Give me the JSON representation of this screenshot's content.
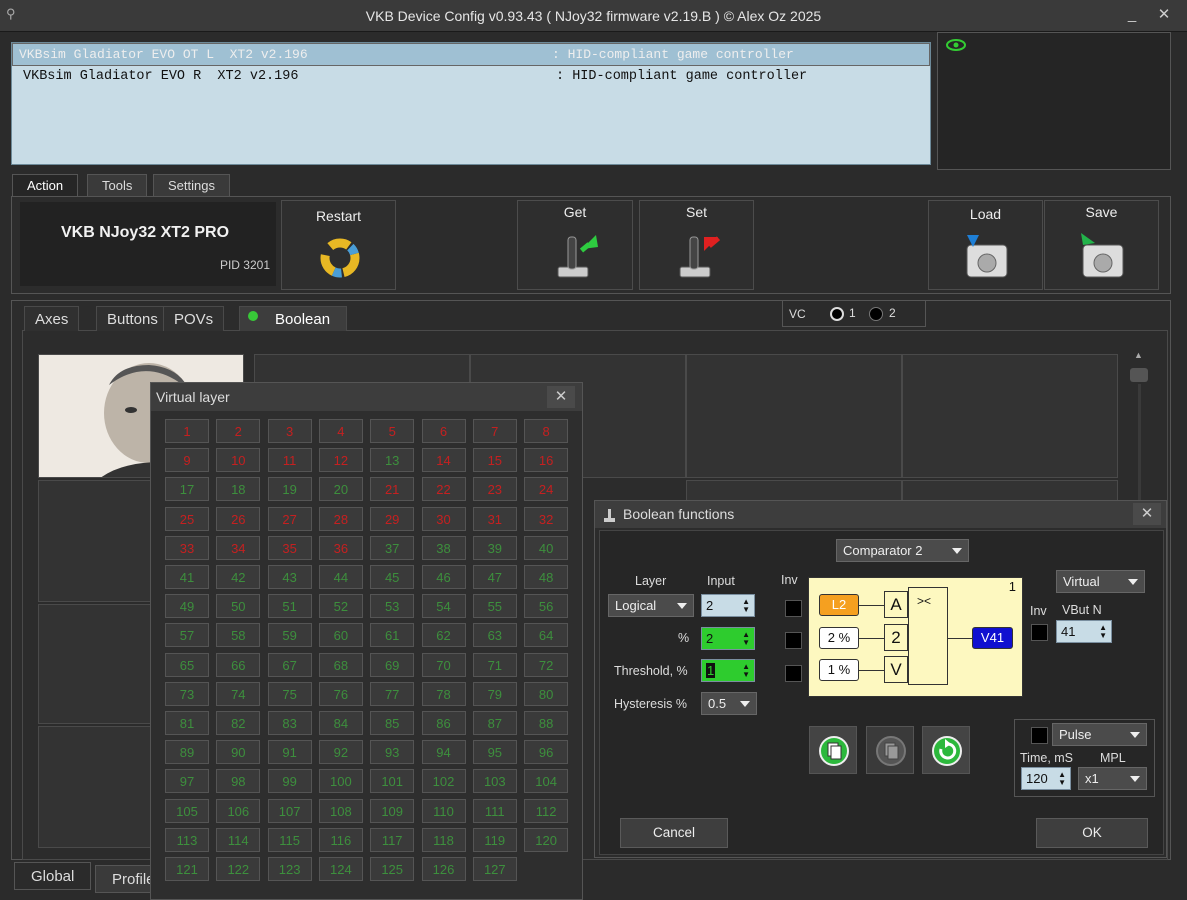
{
  "window": {
    "title": "VKB Device Config v0.93.43 ( NJoy32 firmware v2.19.B ) © Alex Oz 2025",
    "minimize_label": "_",
    "close_label": "✕"
  },
  "devices": [
    {
      "name": "VKBsim Gladiator EVO OT L  XT2 v2.196",
      "type": ": HID-compliant game controller"
    },
    {
      "name": "VKBsim Gladiator EVO R  XT2 v2.196",
      "type": ": HID-compliant game controller"
    }
  ],
  "main_tabs": [
    "Action",
    "Tools",
    "Settings"
  ],
  "action": {
    "device_name": "VKB NJoy32 XT2 PRO",
    "pid": "PID 3201",
    "restart_label": "Restart",
    "get_label": "Get",
    "set_label": "Set",
    "load_label": "Load",
    "save_label": "Save"
  },
  "sub_tabs": [
    "Axes",
    "Buttons",
    "POVs",
    "Boolean"
  ],
  "vc": {
    "label": "VC",
    "opt1": "1",
    "opt2": "2"
  },
  "bottom_tabs": [
    "Global",
    "Profile"
  ],
  "virtual_layer": {
    "title": "Virtual layer",
    "close_label": "✕",
    "buttons": [
      "1",
      "2",
      "3",
      "4",
      "5",
      "6",
      "7",
      "8",
      "9",
      "10",
      "11",
      "12",
      "13",
      "14",
      "15",
      "16",
      "17",
      "18",
      "19",
      "20",
      "21",
      "22",
      "23",
      "24",
      "25",
      "26",
      "27",
      "28",
      "29",
      "30",
      "31",
      "32",
      "33",
      "34",
      "35",
      "36",
      "37",
      "38",
      "39",
      "40",
      "41",
      "42",
      "43",
      "44",
      "45",
      "46",
      "47",
      "48",
      "49",
      "50",
      "51",
      "52",
      "53",
      "54",
      "55",
      "56",
      "57",
      "58",
      "59",
      "60",
      "61",
      "62",
      "63",
      "64",
      "65",
      "66",
      "67",
      "68",
      "69",
      "70",
      "71",
      "72",
      "73",
      "74",
      "75",
      "76",
      "77",
      "78",
      "79",
      "80",
      "81",
      "82",
      "83",
      "84",
      "85",
      "86",
      "87",
      "88",
      "89",
      "90",
      "91",
      "92",
      "93",
      "94",
      "95",
      "96",
      "97",
      "98",
      "99",
      "100",
      "101",
      "102",
      "103",
      "104",
      "105",
      "106",
      "107",
      "108",
      "109",
      "110",
      "111",
      "112",
      "113",
      "114",
      "115",
      "116",
      "117",
      "118",
      "119",
      "120",
      "121",
      "122",
      "123",
      "124",
      "125",
      "126",
      "127"
    ],
    "red_buttons": [
      1,
      2,
      3,
      4,
      5,
      6,
      7,
      8,
      9,
      10,
      11,
      12,
      14,
      15,
      16,
      21,
      22,
      23,
      24,
      25,
      26,
      27,
      28,
      29,
      30,
      31,
      32,
      33,
      34,
      35,
      36
    ]
  },
  "boolean": {
    "title": "Boolean functions",
    "close_label": "✕",
    "function_select": "Comparator 2",
    "layer_label": "Layer",
    "input_label": "Input",
    "inv_label": "Inv",
    "layer_value": "Logical",
    "input_value": "2",
    "percent_label": "%",
    "percent_value": "2",
    "threshold_label": "Threshold, %",
    "threshold_value": "1",
    "hysteresis_label": "Hysteresis %",
    "hysteresis_value": "0.5",
    "diagram": {
      "index": "1",
      "in_a": "L2",
      "in_2": "2 %",
      "in_v": "1 %",
      "gate_a": "A",
      "gate_2": "2",
      "gate_v": "V",
      "op": "><",
      "out": "V41"
    },
    "output_type": "Virtual",
    "out_inv_label": "Inv",
    "vbut_label": "VBut N",
    "vbut_value": "41",
    "pulse_select": "Pulse",
    "time_label": "Time, mS",
    "time_value": "120",
    "mpl_label": "MPL",
    "mpl_value": "x1",
    "cancel_label": "Cancel",
    "ok_label": "OK",
    "colors": {
      "orange": "#f5a020",
      "blue": "#1010d0",
      "green": "#2ecc2e",
      "yellow": "#fdf8c0"
    }
  }
}
